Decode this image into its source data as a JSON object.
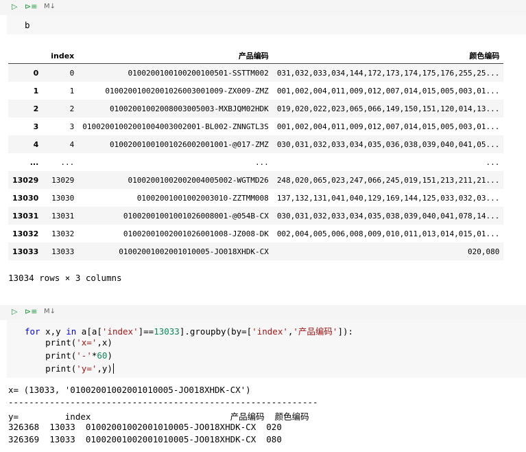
{
  "cell1": {
    "run_icon": "run-icon",
    "toolbar_icon": "run-below-icon",
    "cell_type": "M↓",
    "source": "b"
  },
  "dataframe": {
    "columns": [
      "index",
      "产品编码",
      "颜色编码"
    ],
    "rows": [
      {
        "label": "0",
        "index": "0",
        "code": "0100200100100200100501-SSTTM002",
        "color": "031,032,033,034,144,172,173,174,175,176,255,25..."
      },
      {
        "label": "1",
        "index": "1",
        "code": "0100200100200102600300100​9-ZX009-ZMZ",
        "color": "001,002,004,011,009,012,007,014,015,005,003,01..."
      },
      {
        "label": "2",
        "index": "2",
        "code": "0100200100200800300500​3-MXBJQM02HDK",
        "color": "019,020,022,023,065,066,149,150,151,120,014,13..."
      },
      {
        "label": "3",
        "index": "3",
        "code": "01002001002001004003002001-BL002-ZNNGTL3S",
        "color": "001,002,004,011,009,012,007,014,015,005,003,01..."
      },
      {
        "label": "4",
        "index": "4",
        "code": "0100200100100102600200100​1-@017-ZMZ",
        "color": "030,031,032,033,034,035,036,038,039,040,041,05..."
      },
      {
        "label": "...",
        "index": "...",
        "code": "...",
        "color": "..."
      },
      {
        "label": "13029",
        "index": "13029",
        "code": "0100200100200200400500​2-WGTMD26",
        "color": "248,020,065,023,247,066,245,019,151,213,211,21..."
      },
      {
        "label": "13030",
        "index": "13030",
        "code": "0100200100100200301​0-ZZTMM008",
        "color": "137,132,131,041,040,129,169,144,125,033,032,03..."
      },
      {
        "label": "13031",
        "index": "13031",
        "code": "0100200100100102600800​1-@054B-CX",
        "color": "030,031,032,033,034,035,038,039,040,041,078,14..."
      },
      {
        "label": "13032",
        "index": "13032",
        "code": "0100200100200102600100​8-JZ008-DK",
        "color": "002,004,005,006,008,009,010,011,013,014,015,01..."
      },
      {
        "label": "13033",
        "index": "13033",
        "code": "0100200100200101000​5-JO018XHDK-CX",
        "color": "020,080"
      }
    ],
    "shape": "13034 rows × 3 columns"
  },
  "cell2": {
    "cell_type": "M↓",
    "code_lines": [
      [
        "for",
        " x,y ",
        "in",
        " a[a[",
        "'index'",
        "]==",
        "13033",
        "].groupby(by=[",
        "'index'",
        ",",
        "'产品编码'",
        "]):"
      ],
      [
        "    print(",
        "'x='",
        ",x)"
      ],
      [
        "    print(",
        "'-'",
        "*",
        "60",
        ")"
      ],
      [
        "    print(",
        "'y='",
        ",y)"
      ]
    ],
    "output": [
      "x= (13033, '01002001002001010005-JO018XHDK-CX')",
      "------------------------------------------------------------",
      "y=         index                           产品编码  颜色编码",
      "326368  13033  01002001002001010005-JO018XHDK-CX  020",
      "326369  13033  01002001002001010005-JO018XHDK-CX  080"
    ]
  }
}
